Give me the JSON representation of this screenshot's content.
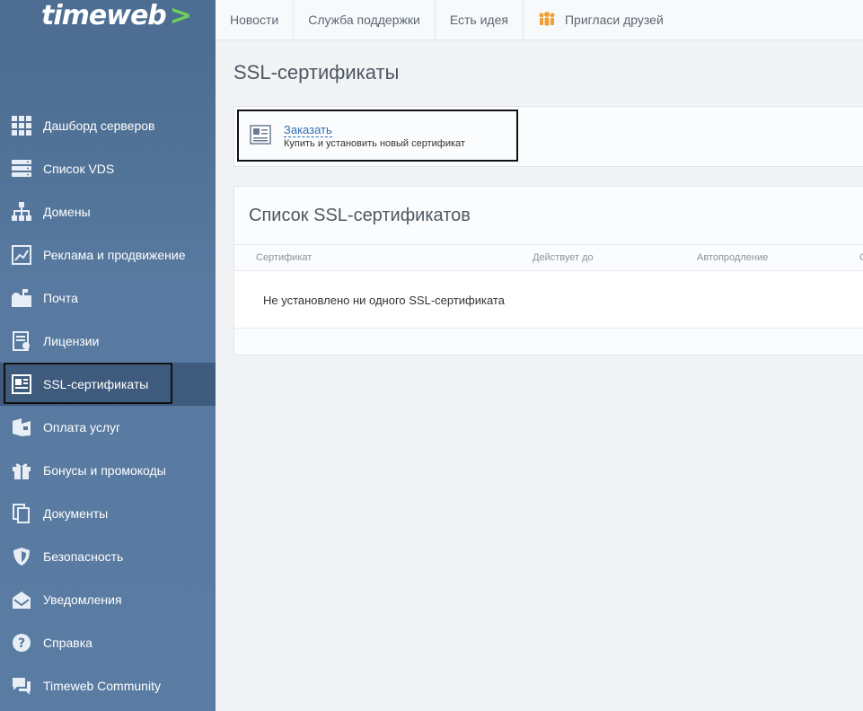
{
  "brand": {
    "logo_text": "timeweb",
    "logo_arrow": ">"
  },
  "topbar": {
    "links": [
      {
        "label": "Новости"
      },
      {
        "label": "Служба поддержки"
      },
      {
        "label": "Есть идея"
      },
      {
        "label": "Пригласи друзей",
        "icon": "people-icon"
      }
    ]
  },
  "sidebar": {
    "items": [
      {
        "label": "Дашборд серверов",
        "icon": "grid-icon"
      },
      {
        "label": "Список VDS",
        "icon": "server-icon"
      },
      {
        "label": "Домены",
        "icon": "sitemap-icon"
      },
      {
        "label": "Реклама и продвижение",
        "icon": "chart-icon"
      },
      {
        "label": "Почта",
        "icon": "mailbox-icon"
      },
      {
        "label": "Лицензии",
        "icon": "license-icon"
      },
      {
        "label": "SSL-сертификаты",
        "icon": "certificate-icon",
        "active": true
      },
      {
        "label": "Оплата услуг",
        "icon": "wallet-icon"
      },
      {
        "label": "Бонусы и промокоды",
        "icon": "gift-icon"
      },
      {
        "label": "Документы",
        "icon": "documents-icon"
      },
      {
        "label": "Безопасность",
        "icon": "shield-icon"
      },
      {
        "label": "Уведомления",
        "icon": "notification-icon"
      },
      {
        "label": "Справка",
        "icon": "help-icon"
      },
      {
        "label": "Timeweb Community",
        "icon": "chat-icon"
      }
    ]
  },
  "main": {
    "page_title": "SSL-сертификаты",
    "order": {
      "link": "Заказать",
      "description": "Купить и установить новый сертификат"
    },
    "list": {
      "title": "Список SSL-сертификатов",
      "columns": [
        "Сертификат",
        "Действует до",
        "Автопродление",
        "С"
      ],
      "empty_message": "Не установлено ни одного SSL-сертификата"
    }
  },
  "colors": {
    "sidebar": "#587aa0",
    "sidebar_active": "#3e5a7c",
    "logo_arrow": "#6fd05a",
    "link": "#2e6db3",
    "invite_icon": "#f0a030"
  }
}
